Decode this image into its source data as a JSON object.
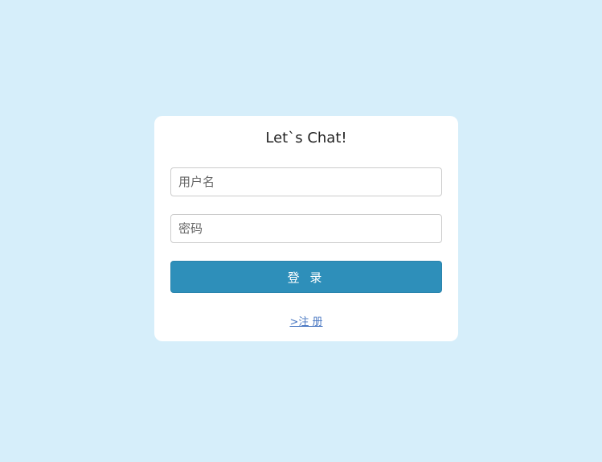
{
  "card": {
    "title": "Let`s Chat!"
  },
  "form": {
    "username_placeholder": "用户名",
    "username_value": "",
    "password_placeholder": "密码",
    "password_value": "",
    "login_label": "登 录",
    "register_label": ">注 册"
  },
  "colors": {
    "background": "#d6eefa",
    "card": "#ffffff",
    "button": "#2e8fba",
    "link": "#4a78c2"
  }
}
